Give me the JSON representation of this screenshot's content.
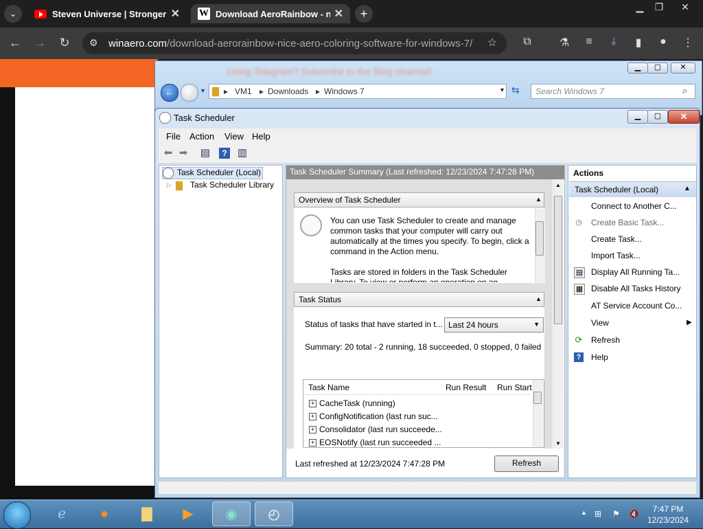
{
  "browser": {
    "tabs": [
      {
        "title": "Steven Universe | Stronger Than You",
        "icon": "youtube-icon",
        "active": false
      },
      {
        "title": "Download AeroRainbow - nice Aero coloring software",
        "icon": "winaero-icon",
        "active": true
      }
    ],
    "new_tab": "+",
    "url_domain": "winaero.com",
    "url_path": "/download-aerorainbow-nice-aero-coloring-software-for-windows-7/"
  },
  "explorer": {
    "banner_blur": "Using Telegram? Subscribe to the Blog channel!",
    "path": [
      "VM1",
      "Downloads",
      "Windows 7"
    ],
    "search_placeholder": "Search Windows 7"
  },
  "task_scheduler": {
    "title": "Task Scheduler",
    "menu": [
      "File",
      "Action",
      "View",
      "Help"
    ],
    "tree": {
      "root": "Task Scheduler (Local)",
      "child": "Task Scheduler Library"
    },
    "summary_header": "Task Scheduler Summary (Last refreshed: 12/23/2024 7:47:28 PM)",
    "overview": {
      "title": "Overview of Task Scheduler",
      "text1": "You can use Task Scheduler to create and manage common tasks that your computer will carry out automatically at the times you specify. To begin, click a command in the Action menu.",
      "text2": "Tasks are stored in folders in the Task Scheduler Library. To view or perform an operation on an"
    },
    "status": {
      "title": "Task Status",
      "label": "Status of tasks that have started in t...",
      "dropdown_value": "Last 24 hours",
      "summary": "Summary: 20 total - 2 running, 18 succeeded, 0 stopped, 0 failed",
      "columns": [
        "Task Name",
        "Run Result",
        "Run Start"
      ],
      "rows": [
        "CacheTask (running)",
        "ConfigNotification (last run suc...",
        "Consolidator (last run succeede...",
        "EOSNotify (last run succeeded ..."
      ]
    },
    "last_refreshed": "Last refreshed at 12/23/2024 7:47:28 PM",
    "refresh_button": "Refresh",
    "actions": {
      "title": "Actions",
      "subtitle": "Task Scheduler (Local)",
      "items": [
        "Connect to Another C...",
        "Create Basic Task...",
        "Create Task...",
        "Import Task...",
        "Display All Running Ta...",
        "Disable All Tasks History",
        "AT Service Account Co...",
        "View",
        "Refresh",
        "Help"
      ]
    }
  },
  "taskbar": {
    "time": "7:47 PM",
    "date": "12/23/2024"
  }
}
